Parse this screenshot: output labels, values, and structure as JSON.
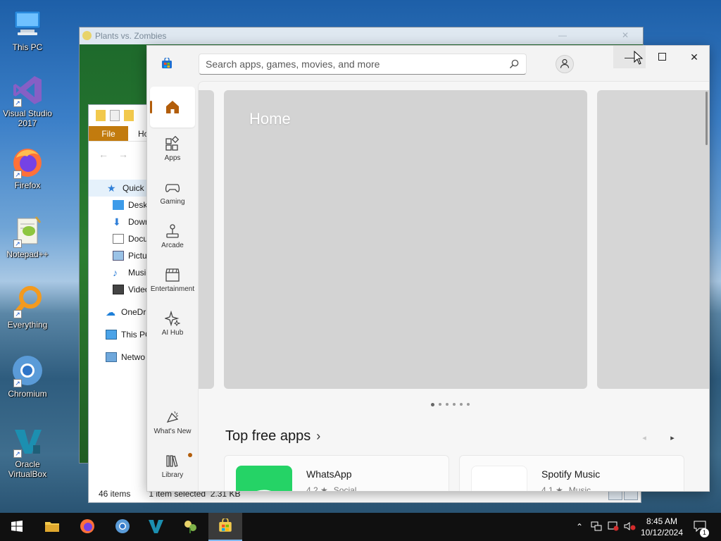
{
  "desktop": {
    "icons": [
      {
        "label": "This PC",
        "icon": "computer-icon"
      },
      {
        "label": "Visual Studio 2017",
        "icon": "visual-studio-icon"
      },
      {
        "label": "Firefox",
        "icon": "firefox-icon"
      },
      {
        "label": "Notepad++",
        "icon": "notepadpp-icon"
      },
      {
        "label": "Everything",
        "icon": "everything-search-icon"
      },
      {
        "label": "Chromium",
        "icon": "chromium-icon"
      },
      {
        "label": "Oracle VirtualBox",
        "icon": "virtualbox-icon"
      }
    ]
  },
  "pvz_window": {
    "title": "Plants vs. Zombies"
  },
  "explorer": {
    "ribbon": {
      "file": "File",
      "home": "Ho"
    },
    "tree": [
      {
        "label": "Quick a",
        "icon": "star-icon",
        "selected": true
      },
      {
        "label": "Deskt",
        "icon": "desktop-folder-icon"
      },
      {
        "label": "Down",
        "icon": "download-icon"
      },
      {
        "label": "Docu",
        "icon": "document-icon"
      },
      {
        "label": "Pictu",
        "icon": "pictures-icon"
      },
      {
        "label": "Music",
        "icon": "music-icon"
      },
      {
        "label": "Video",
        "icon": "video-icon"
      },
      {
        "label": "OneDri",
        "icon": "onedrive-icon"
      },
      {
        "label": "This PC",
        "icon": "computer-icon"
      },
      {
        "label": "Netwo",
        "icon": "network-icon"
      }
    ],
    "status": {
      "items": "46 items",
      "selected": "1 item selected",
      "size": "2.31 KB"
    }
  },
  "store": {
    "search_placeholder": "Search apps, games, movies, and more",
    "nav": [
      {
        "label": "",
        "icon": "home-icon",
        "active": true
      },
      {
        "label": "Apps",
        "icon": "apps-icon"
      },
      {
        "label": "Gaming",
        "icon": "gamepad-icon"
      },
      {
        "label": "Arcade",
        "icon": "joystick-icon"
      },
      {
        "label": "Entertainment",
        "icon": "clapperboard-icon"
      },
      {
        "label": "AI Hub",
        "icon": "sparkle-icon"
      }
    ],
    "nav_bottom": [
      {
        "label": "What's New",
        "icon": "megaphone-icon"
      },
      {
        "label": "Library",
        "icon": "library-icon",
        "badge": true
      }
    ],
    "hero_title": "Home",
    "carousel": {
      "count": 6,
      "active_index": 0
    },
    "section_title": "Top free apps",
    "apps": [
      {
        "name": "WhatsApp",
        "rating": "4.2 ★",
        "category": "Social",
        "color": "#25d366"
      },
      {
        "name": "Spotify Music",
        "rating": "4.1 ★",
        "category": "Music",
        "color": "#1ed760"
      }
    ],
    "accent": "#b25d0a"
  },
  "taskbar": {
    "apps": [
      {
        "name": "start-button",
        "icon": "windows-logo-icon"
      },
      {
        "name": "taskbar-file-explorer",
        "icon": "folder-icon"
      },
      {
        "name": "taskbar-firefox",
        "icon": "firefox-icon"
      },
      {
        "name": "taskbar-chromium",
        "icon": "chromium-icon"
      },
      {
        "name": "taskbar-virtualbox",
        "icon": "virtualbox-icon"
      },
      {
        "name": "taskbar-pvz",
        "icon": "pvz-icon"
      },
      {
        "name": "taskbar-store",
        "icon": "store-icon",
        "active": true
      }
    ],
    "time": "8:45 AM",
    "date": "10/12/2024",
    "notification_count": "1"
  }
}
